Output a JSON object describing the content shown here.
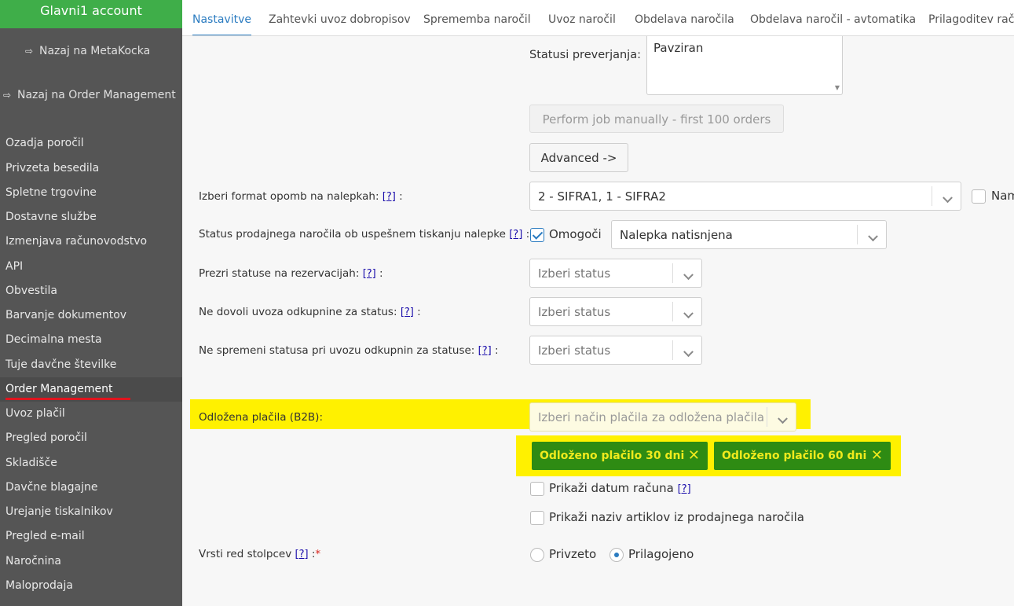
{
  "sidebar": {
    "account": "Glavni1 account",
    "back_metakocka": "Nazaj na MetaKocka",
    "back_order_mgmt": "Nazaj na Order Management",
    "items": [
      "Ozadja poročil",
      "Privzeta besedila",
      "Spletne trgovine",
      "Dostavne službe",
      "Izmenjava računovodstvo",
      "API",
      "Obvestila",
      "Barvanje dokumentov",
      "Decimalna mesta",
      "Tuje davčne številke",
      "Order Management",
      "Uvoz plačil",
      "Pregled poročil",
      "Skladišče",
      "Davčne blagajne",
      "Urejanje tiskalnikov",
      "Pregled e-mail",
      "Naročnina",
      "Maloprodaja"
    ]
  },
  "tabs": [
    "Nastavitve",
    "Zahtevki uvoz dobropisov",
    "Sprememba naročil",
    "Uvoz naročil",
    "Obdelava naročila",
    "Obdelava naročil - avtomatika",
    "Prilagoditev raču"
  ],
  "form": {
    "statusi_label": "Statusi preverjanja:",
    "statusi_value": "Pavziran",
    "perform_button": "Perform job manually - first 100 orders",
    "advanced_button": "Advanced ->",
    "format_label": "Izberi format opomb na nalepkah:",
    "format_value": "2 - SIFRA1, 1 - SIFRA2",
    "format_extra": "Nam",
    "status_print_label": "Status prodajnega naročila ob uspešnem tiskanju nalepke",
    "omogoci": "Omogoči",
    "status_print_value": "Nalepka natisnjena",
    "prezri_label": "Prezri statuse na rezervacijah:",
    "ne_dovoli_label": "Ne dovoli uvoza odkupnine za status:",
    "ne_spremeni_label": "Ne spremeni statusa pri uvozu odkupnin za statuse:",
    "izberi_status": "Izberi status",
    "odlozena_label": "Odložena plačila (B2B):",
    "odlozena_placeholder": "Izberi način plačila za odložena plačila",
    "tags": [
      "Odloženo plačilo 30 dni",
      "Odloženo plačilo 60 dni"
    ],
    "tag_remove": "✕",
    "prikazi_datum": "Prikaži datum računa",
    "prikazi_naziv": "Prikaži naziv artiklov iz prodajnega naročila",
    "vrsti_label": "Vrsti red stolpcev",
    "privzeto": "Privzeto",
    "prilagojeno": "Prilagojeno",
    "help": "[?]",
    "colon": ":",
    "required": "*"
  },
  "colors": {
    "sidebar_bg": "#555555",
    "account_bg": "#3fae49",
    "tab_active": "#2a7bc0",
    "highlight": "#fff100",
    "tag_bg": "#2e8b13",
    "tag_text": "#f0ea1d"
  }
}
